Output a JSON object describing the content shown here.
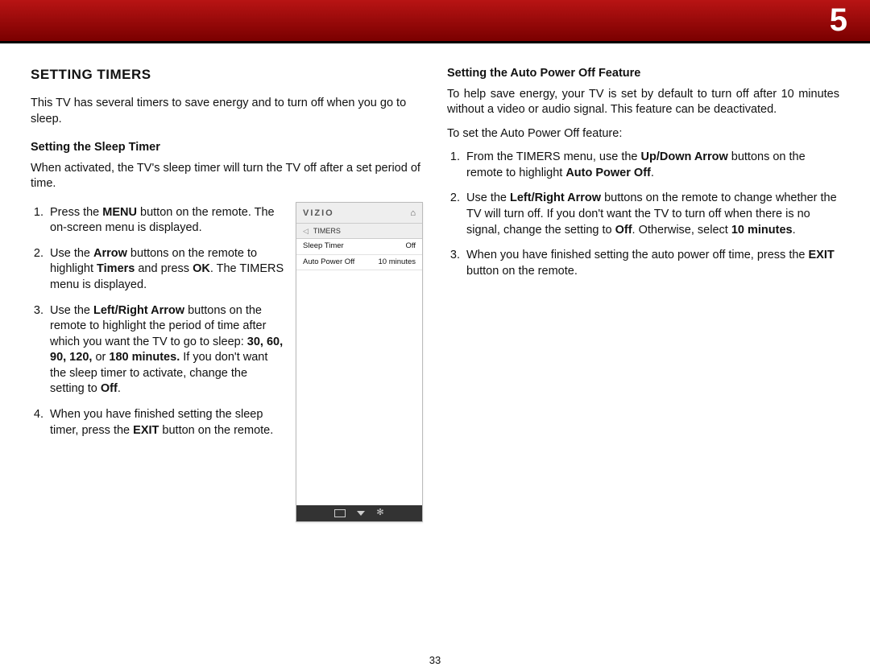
{
  "chapter": "5",
  "pageNumber": "33",
  "left": {
    "title": "SETTING TIMERS",
    "intro": "This TV has several timers to save energy and to turn off when you go to sleep.",
    "sub1": "Setting the Sleep Timer",
    "sub1_para": "When activated, the TV's sleep timer will turn the TV off after a set period of time.",
    "steps": {
      "s1_a": "Press the ",
      "s1_b": "MENU",
      "s1_c": " button on the remote. The on-screen menu is displayed.",
      "s2_a": "Use the ",
      "s2_b": "Arrow",
      "s2_c": " buttons on the remote to highlight ",
      "s2_d": "Timers",
      "s2_e": " and press ",
      "s2_f": "OK",
      "s2_g": ". The TIMERS menu is displayed.",
      "s3_a": "Use the ",
      "s3_b": "Left/Right Arrow",
      "s3_c": " buttons on the remote to highlight the period of time after which you want the TV to go to sleep: ",
      "s3_d": "30, 60, 90, 120,",
      "s3_e": " or ",
      "s3_f": "180 minutes.",
      "s3_g": " If you don't want the sleep timer to activate, change the setting to ",
      "s3_h": "Off",
      "s3_i": ".",
      "s4_a": "When you have finished setting the sleep timer, press the ",
      "s4_b": "EXIT",
      "s4_c": " button on the remote."
    }
  },
  "tvmenu": {
    "brand": "VIZIO",
    "breadcrumb": "TIMERS",
    "row1_label": "Sleep Timer",
    "row1_value": "Off",
    "row2_label": "Auto Power Off",
    "row2_value": "10 minutes"
  },
  "right": {
    "sub": "Setting the Auto Power Off Feature",
    "intro": "To help save energy, your TV is set by default to turn off after 10 minutes without a video or audio signal. This feature can be deactivated.",
    "lead": "To set the Auto Power Off feature:",
    "steps": {
      "s1_a": "From the TIMERS menu, use the ",
      "s1_b": "Up/Down Arrow",
      "s1_c": " buttons on the remote to highlight ",
      "s1_d": "Auto Power Off",
      "s1_e": ".",
      "s2_a": "Use the ",
      "s2_b": "Left/Right Arrow",
      "s2_c": " buttons on the remote to change whether the TV will turn off. If you don't want the TV to turn off when there is no signal, change the setting to ",
      "s2_d": "Off",
      "s2_e": ". Otherwise, select ",
      "s2_f": "10 minutes",
      "s2_g": ".",
      "s3_a": "When you have finished setting the auto power off time, press the ",
      "s3_b": "EXIT",
      "s3_c": " button on the remote."
    }
  }
}
